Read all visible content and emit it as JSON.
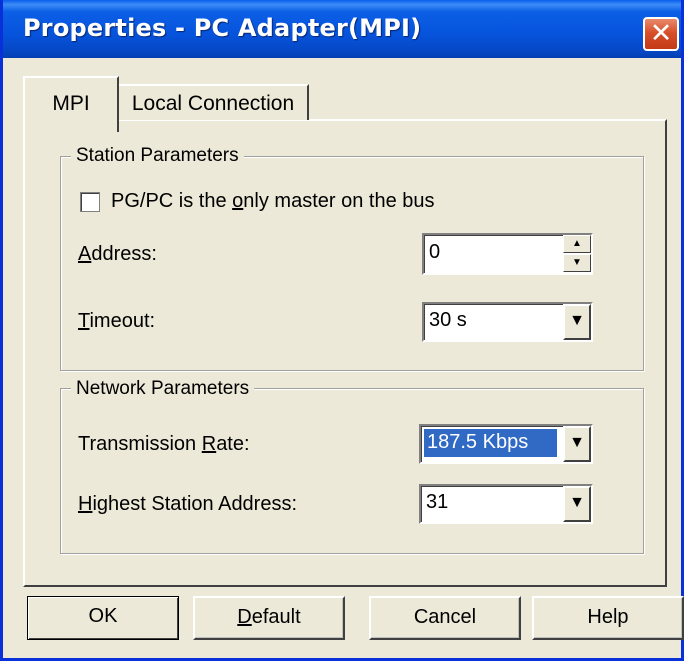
{
  "window": {
    "title": "Properties - PC Adapter(MPI)",
    "close_glyph": "✕"
  },
  "tabs": [
    {
      "label": "MPI",
      "selected": true
    },
    {
      "label": "Local Connection",
      "selected": false
    }
  ],
  "station": {
    "legend": "Station Parameters",
    "checkbox_label": "PG/PC is the only master on the bus",
    "checkbox_checked": false,
    "address_label": "Address:",
    "address_value": "0",
    "timeout_label": "Timeout:",
    "timeout_value": "30 s"
  },
  "network": {
    "legend": "Network Parameters",
    "rate_label": "Transmission Rate:",
    "rate_value": "187.5 Kbps",
    "highest_label": "Highest Station Address:",
    "highest_value": "31"
  },
  "buttons": {
    "ok": "OK",
    "default": "Default",
    "cancel": "Cancel",
    "help": "Help"
  },
  "colors": {
    "titlebar": "#0653dc",
    "face": "#ece9d8",
    "selection": "#316ac5",
    "close_button": "#c23a16"
  },
  "icons": {
    "spin_up": "▲",
    "spin_down": "▼",
    "dropdown": "▼"
  }
}
